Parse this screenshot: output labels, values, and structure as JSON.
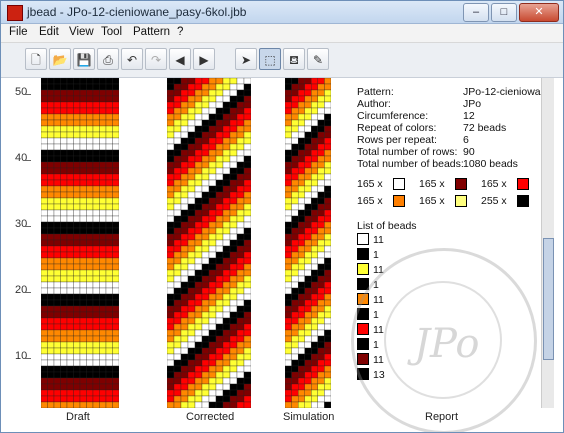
{
  "window": {
    "title": "jbead - JPo-12-cieniowane_pasy-6kol.jbb"
  },
  "menu": [
    "File",
    "Edit",
    "View",
    "Tool",
    "Pattern",
    "?"
  ],
  "toolbar": [
    "new-icon",
    "open-icon",
    "save-icon",
    "print-icon",
    "undo-icon",
    "redo-icon",
    "arrow-left-icon",
    "arrow-right-icon",
    "pointer-icon",
    "select-icon",
    "fill-icon",
    "pipette-icon"
  ],
  "palette": [
    "#ffffff",
    "#000000",
    "#7f0000",
    "#ff0000",
    "#ff00ff",
    "#7f007f",
    "#ffff00",
    "#fffb7f",
    "#00ff00",
    "#007f00",
    "#00ffff",
    "#007f7f",
    "#0000ff",
    "#00007f",
    "#7f7f7f",
    "#c0c0c0",
    "#ffffff",
    "#ff0000",
    "#ff7f00",
    "#ffff00",
    "#c0c0c0",
    "#7f7f7f",
    "#ff0000",
    "#00ff00",
    "#00ffff",
    "#ffcc99",
    "#ff00ff",
    "#7f7f00",
    "#007f7f",
    "#7f7fff",
    "#ff7f7f",
    "#c0c0c0"
  ],
  "ruler": [
    "50",
    "40",
    "30",
    "20",
    "10"
  ],
  "labels": {
    "draft": "Draft",
    "corrected": "Corrected",
    "simulation": "Simulation",
    "report": "Report"
  },
  "report": {
    "rows": [
      {
        "k": "Pattern:",
        "v": "JPo-12-cieniowan"
      },
      {
        "k": "Author:",
        "v": "JPo"
      },
      {
        "k": "Circumference:",
        "v": "12"
      },
      {
        "k": "Repeat of colors:",
        "v": "72 beads"
      },
      {
        "k": "Rows per repeat:",
        "v": "6"
      },
      {
        "k": "Total number of rows:",
        "v": "90"
      },
      {
        "k": "Total number of beads:",
        "v": "1080 beads"
      }
    ],
    "counts": [
      {
        "n": "165 x",
        "color": "#ffffff"
      },
      {
        "n": "165 x",
        "color": "#7f0000"
      },
      {
        "n": "165 x",
        "color": "#ff0000"
      },
      {
        "n": "165 x",
        "color": "#ff7f00"
      },
      {
        "n": "165 x",
        "color": "#ffff7f"
      },
      {
        "n": "255 x",
        "color": "#000000"
      }
    ],
    "list_title": "List of beads",
    "list": [
      {
        "n": "11",
        "color": "#ffffff"
      },
      {
        "n": "1",
        "color": "#000000"
      },
      {
        "n": "11",
        "color": "#ffff33"
      },
      {
        "n": "1",
        "color": "#000000"
      },
      {
        "n": "11",
        "color": "#ff8800"
      },
      {
        "n": "1",
        "color": "#000000"
      },
      {
        "n": "11",
        "color": "#ff0000"
      },
      {
        "n": "1",
        "color": "#000000"
      },
      {
        "n": "11",
        "color": "#7f0000"
      },
      {
        "n": "13",
        "color": "#000000"
      }
    ]
  }
}
